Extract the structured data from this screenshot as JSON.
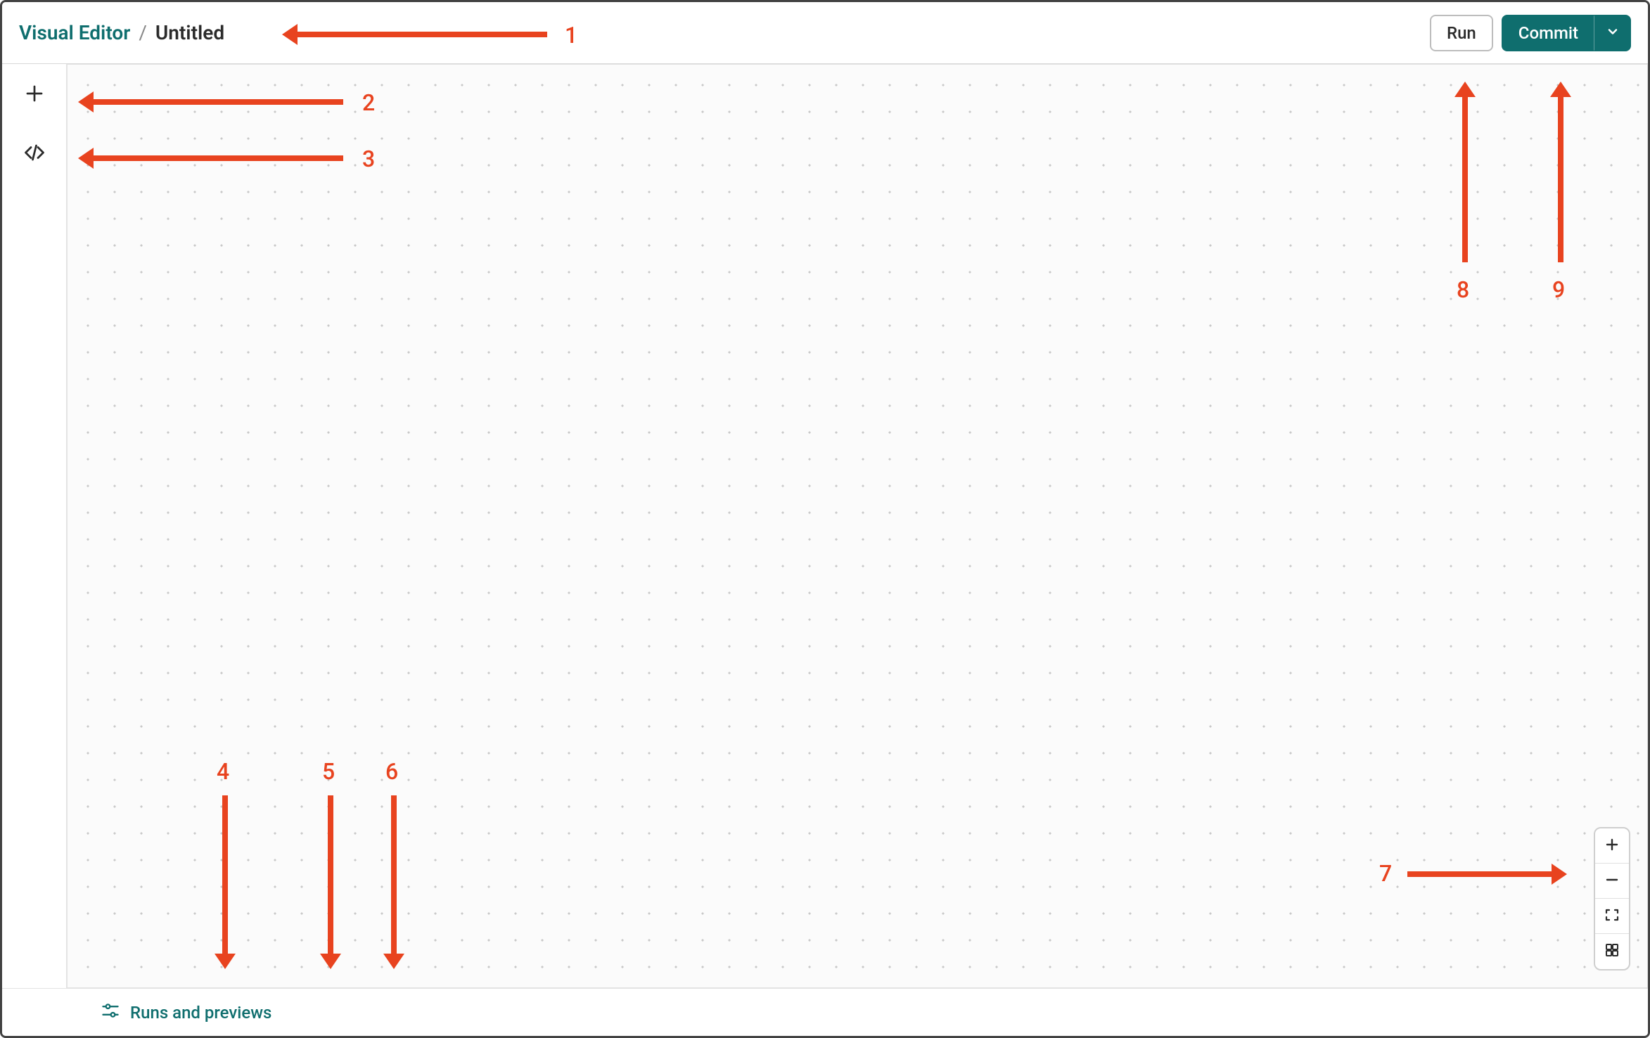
{
  "header": {
    "breadcrumb_root": "Visual Editor",
    "breadcrumb_separator": "/",
    "breadcrumb_current": "Untitled",
    "run_label": "Run",
    "commit_label": "Commit"
  },
  "side_rail": {
    "add_icon": "plus-icon",
    "code_icon": "code-icon"
  },
  "zoom_controls": {
    "zoom_in": "plus",
    "zoom_out": "minus",
    "fit": "fit-screen",
    "grid": "grid-view"
  },
  "footer": {
    "runs_label": "Runs and previews",
    "commit_icon": "git-commit",
    "compass_icon": "compass"
  },
  "annotations": {
    "n1": "1",
    "n2": "2",
    "n3": "3",
    "n4": "4",
    "n5": "5",
    "n6": "6",
    "n7": "7",
    "n8": "8",
    "n9": "9"
  },
  "colors": {
    "accent_teal": "#0f6e6e",
    "annotation_red": "#e8431f",
    "border_gray": "#d8d8d8"
  }
}
